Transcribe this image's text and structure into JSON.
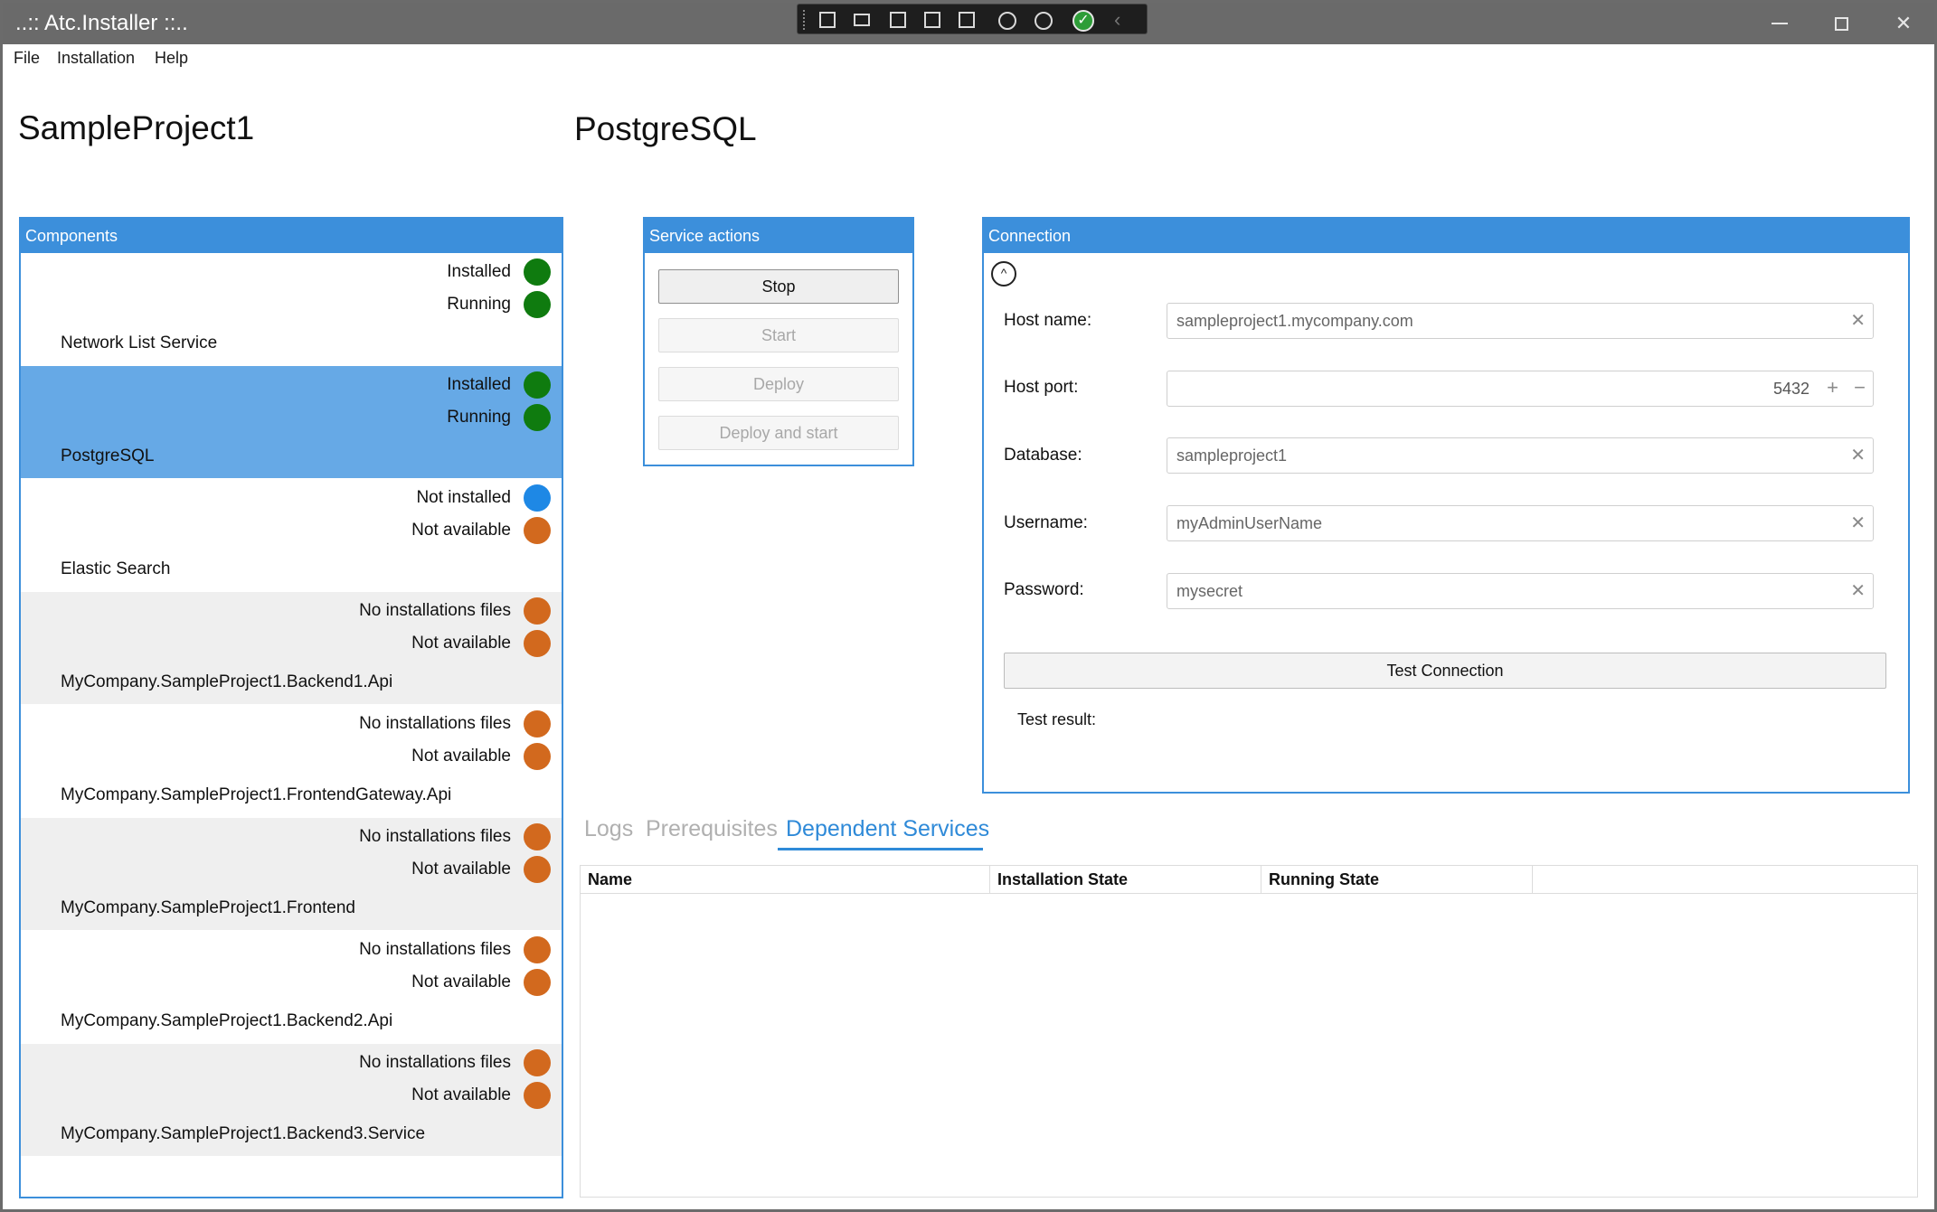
{
  "window": {
    "title": "..:: Atc.Installer ::.."
  },
  "menu": [
    "File",
    "Installation",
    "Help"
  ],
  "project_title": "SampleProject1",
  "detail_title": "PostgreSQL",
  "components_panel": {
    "header": "Components",
    "items": [
      {
        "name": "Network List Service",
        "installation_state": "Installed",
        "installation_color": "#0f7b0f",
        "running_state": "Running",
        "running_color": "#0f7b0f",
        "selected": false
      },
      {
        "name": "PostgreSQL",
        "installation_state": "Installed",
        "installation_color": "#0f7b0f",
        "running_state": "Running",
        "running_color": "#0f7b0f",
        "selected": true
      },
      {
        "name": "Elastic Search",
        "installation_state": "Not installed",
        "installation_color": "#1e88e5",
        "running_state": "Not available",
        "running_color": "#d2691e",
        "selected": false
      },
      {
        "name": "MyCompany.SampleProject1.Backend1.Api",
        "installation_state": "No installations files",
        "installation_color": "#d2691e",
        "running_state": "Not available",
        "running_color": "#d2691e",
        "selected": false
      },
      {
        "name": "MyCompany.SampleProject1.FrontendGateway.Api",
        "installation_state": "No installations files",
        "installation_color": "#d2691e",
        "running_state": "Not available",
        "running_color": "#d2691e",
        "selected": false
      },
      {
        "name": "MyCompany.SampleProject1.Frontend",
        "installation_state": "No installations files",
        "installation_color": "#d2691e",
        "running_state": "Not available",
        "running_color": "#d2691e",
        "selected": false
      },
      {
        "name": "MyCompany.SampleProject1.Backend2.Api",
        "installation_state": "No installations files",
        "installation_color": "#d2691e",
        "running_state": "Not available",
        "running_color": "#d2691e",
        "selected": false
      },
      {
        "name": "MyCompany.SampleProject1.Backend3.Service",
        "installation_state": "No installations files",
        "installation_color": "#d2691e",
        "running_state": "Not available",
        "running_color": "#d2691e",
        "selected": false
      }
    ]
  },
  "service_actions": {
    "header": "Service actions",
    "buttons": [
      {
        "label": "Stop",
        "enabled": true
      },
      {
        "label": "Start",
        "enabled": false
      },
      {
        "label": "Deploy",
        "enabled": false
      },
      {
        "label": "Deploy and start",
        "enabled": false
      }
    ]
  },
  "connection": {
    "header": "Connection",
    "host_name": {
      "label": "Host name:",
      "value": "sampleproject1.mycompany.com"
    },
    "host_port": {
      "label": "Host port:",
      "value": "5432"
    },
    "database": {
      "label": "Database:",
      "value": "sampleproject1"
    },
    "username": {
      "label": "Username:",
      "value": "myAdminUserName"
    },
    "password": {
      "label": "Password:",
      "value": "mysecret"
    },
    "test_button": "Test Connection",
    "test_result_label": "Test result:"
  },
  "tabs": [
    {
      "label": "Logs",
      "active": false
    },
    {
      "label": "Prerequisites",
      "active": false
    },
    {
      "label": "Dependent Services",
      "active": true
    }
  ],
  "dependent_services_grid": {
    "columns": [
      "Name",
      "Installation State",
      "Running State",
      ""
    ],
    "rows": []
  },
  "colors": {
    "accent": "#3c8fdb",
    "selected_row": "#66a9e6",
    "ok": "#0f7b0f",
    "info": "#1e88e5",
    "warning": "#d2691e"
  }
}
